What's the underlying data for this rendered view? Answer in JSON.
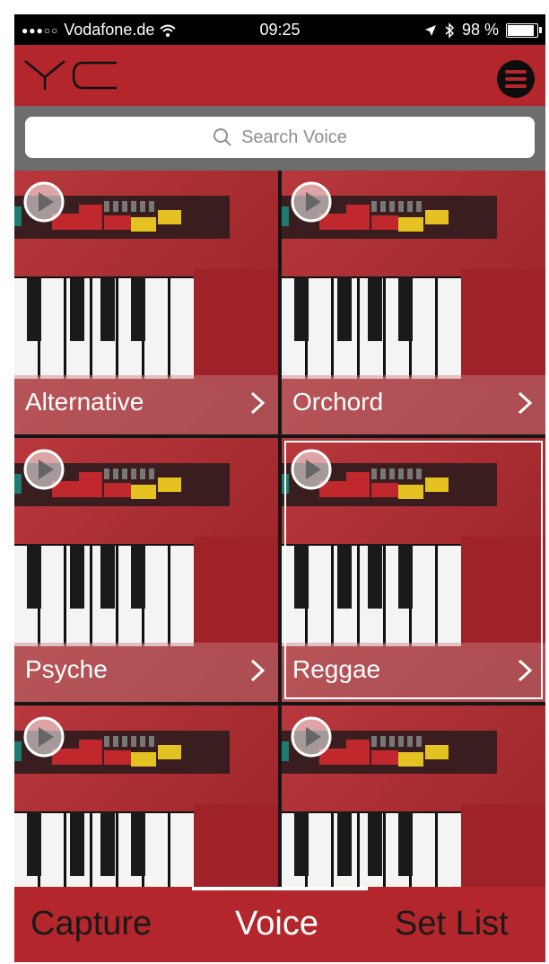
{
  "status_bar": {
    "carrier": "Vodafone.de",
    "time": "09:25",
    "battery": "98 %",
    "battery_level": 0.98
  },
  "header": {
    "logo_text": "YC"
  },
  "search": {
    "placeholder": "Search Voice"
  },
  "voices": [
    {
      "name": "Alternative",
      "selected": false
    },
    {
      "name": "Orchord",
      "selected": false
    },
    {
      "name": "Psyche",
      "selected": false
    },
    {
      "name": "Reggae",
      "selected": true
    },
    {
      "name": "",
      "selected": false
    },
    {
      "name": "",
      "selected": false
    }
  ],
  "tabs": {
    "capture": "Capture",
    "voice": "Voice",
    "set_list": "Set List",
    "active": "voice"
  },
  "colors": {
    "header_red": "#b3262b",
    "search_bar_gray": "#6d6d6d",
    "active_tab_text": "#ffffff",
    "inactive_tab_text": "#1a1a1a"
  },
  "icons": [
    "wifi-icon",
    "location-icon",
    "bluetooth-icon",
    "battery-icon",
    "menu-icon",
    "search-icon",
    "play-icon",
    "chevron-right-icon"
  ]
}
